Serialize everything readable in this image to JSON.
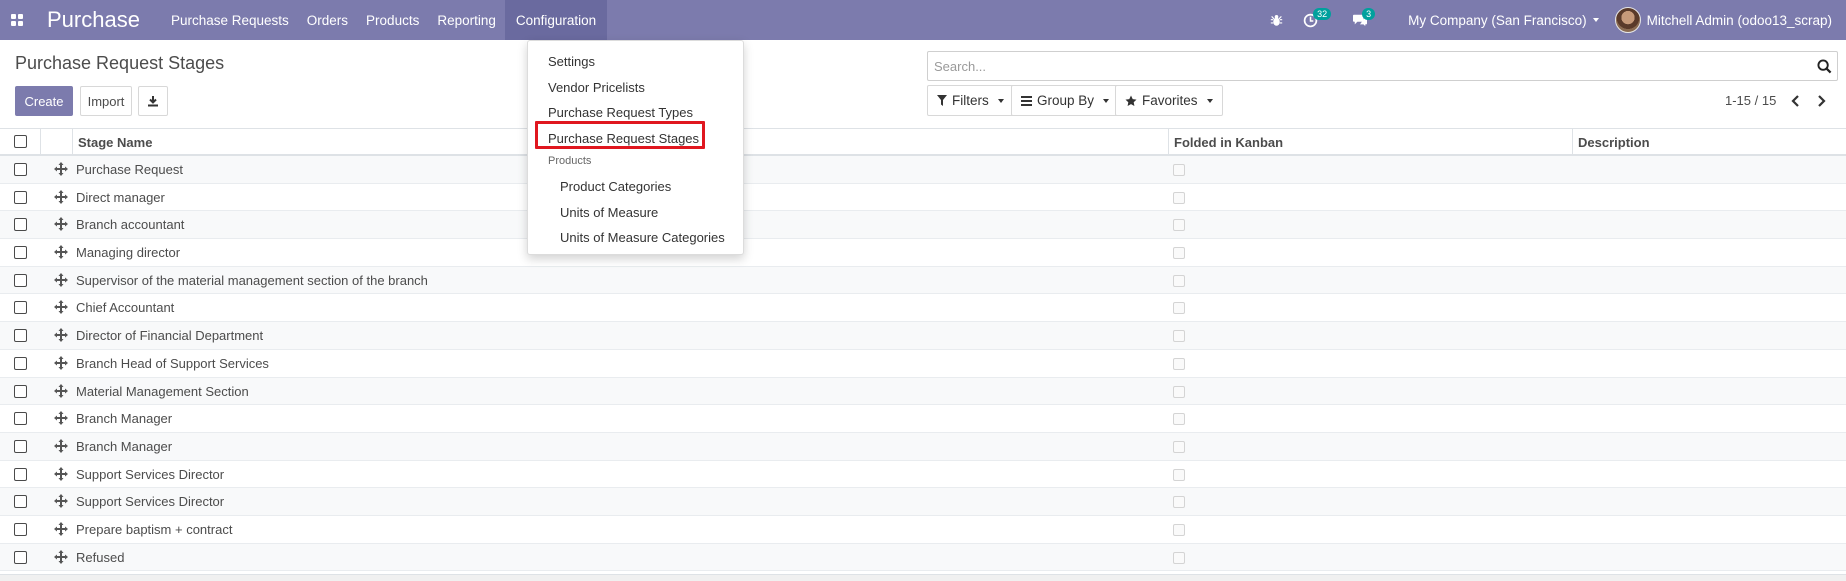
{
  "navbar": {
    "app_name": "Purchase",
    "menu": [
      "Purchase Requests",
      "Orders",
      "Products",
      "Reporting",
      "Configuration"
    ],
    "activities_count": "32",
    "messages_count": "3",
    "company": "My Company (San Francisco)",
    "user": "Mitchell Admin (odoo13_scrap)",
    "accent_color": "#7c7bad"
  },
  "control_panel": {
    "title": "Purchase Request Stages",
    "create_label": "Create",
    "import_label": "Import",
    "search_placeholder": "Search...",
    "filters_label": "Filters",
    "groupby_label": "Group By",
    "favorites_label": "Favorites",
    "pager": "1-15 / 15"
  },
  "table": {
    "columns": [
      "Stage Name",
      "Folded in Kanban",
      "Description"
    ],
    "rows": [
      "Purchase Request",
      "Direct manager",
      "Branch accountant",
      "Managing director",
      "Supervisor of the material management section of the branch",
      "Chief Accountant",
      "Director of Financial Department",
      "Branch Head of Support Services",
      "Material Management Section",
      "Branch Manager",
      "Branch Manager",
      "Support Services Director",
      "Support Services Director",
      "Prepare baptism + contract",
      "Refused"
    ]
  },
  "dropdown": {
    "items": [
      "Settings",
      "Vendor Pricelists",
      "Purchase Request Types",
      "Purchase Request Stages"
    ],
    "section_header": "Products",
    "sub_items": [
      "Product Categories",
      "Units of Measure",
      "Units of Measure Categories"
    ],
    "highlighted": "Purchase Request Stages",
    "highlight_color": "#e0171f"
  }
}
